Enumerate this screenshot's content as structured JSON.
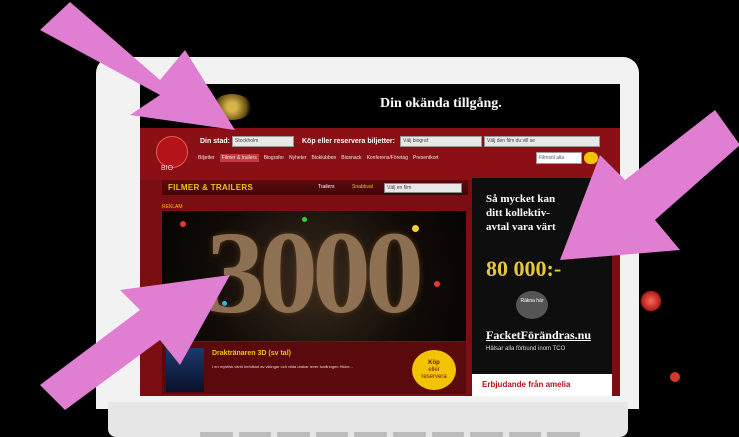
{
  "banner": {
    "text": "Din okända tillgång."
  },
  "site": {
    "logo_text": "BIO",
    "city_label": "Din stad:",
    "city_value": "Stockholm",
    "ticket_label": "Köp eller reservera biljetter:",
    "ticket_select1": "Välj biograf",
    "ticket_select2": "Välj den film du vill se",
    "search_placeholder": "Filmsöl alla",
    "nav": [
      {
        "label": "Biljetter",
        "active": false
      },
      {
        "label": "Filmer & trailers",
        "active": true
      },
      {
        "label": "Biografer",
        "active": false
      },
      {
        "label": "Nyheter",
        "active": false
      },
      {
        "label": "Bioklubben",
        "active": false
      },
      {
        "label": "Biosnack",
        "active": false
      },
      {
        "label": "Konferens/Företag",
        "active": false
      },
      {
        "label": "Presentkort",
        "active": false
      }
    ]
  },
  "section": {
    "title": "FILMER & TRAILERS",
    "tab1": "Trailers",
    "tab2": "Snabbval",
    "film_select": "Välj en film"
  },
  "hero": {
    "reklam": "REKLAM",
    "number": "3000"
  },
  "feature": {
    "title": "Draktränaren 3D (sv tal)",
    "description": "I en mystisk värld befolkad av vikingar och vilda drakar lever tonåringen Hicke...",
    "buy_line1": "Köp",
    "buy_line2": "eller",
    "buy_line3": "reservera"
  },
  "ad": {
    "headline_line1": "Så mycket kan",
    "headline_line2": "ditt kollektiv-",
    "headline_line3": "avtal vara värt",
    "amount": "80 000:-",
    "button": "Räkna här",
    "site": "FacketFörändras.nu",
    "sub": "Hälsar alla förbund inom TCO"
  },
  "ad2": {
    "text": "Erbjudande från amelia"
  },
  "colors": {
    "arrow": "#e07ed2",
    "site_red": "#8b1015",
    "accent_yellow": "#f3c20f"
  },
  "icons": {
    "logo": "sf-bio-logo-icon",
    "go": "search-go-icon"
  }
}
